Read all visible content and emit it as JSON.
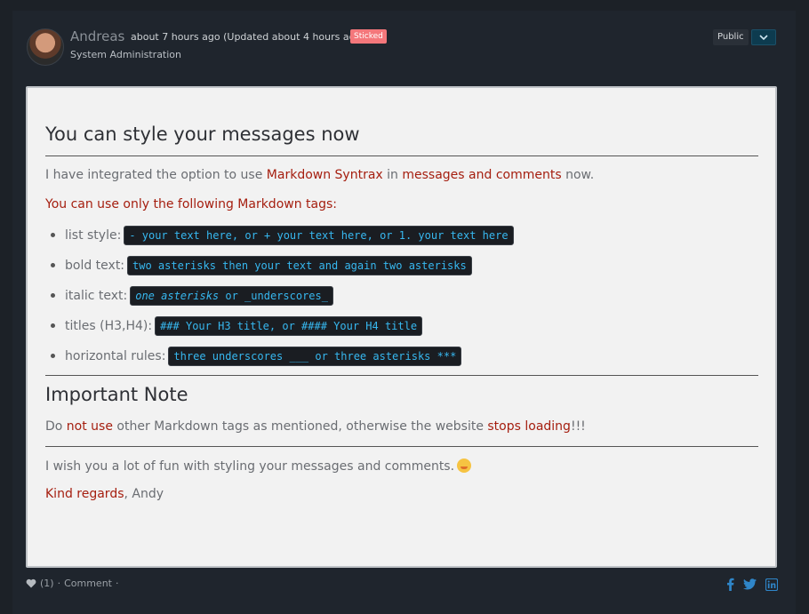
{
  "post": {
    "author": "Andreas",
    "time": "about 7 hours ago (Updated about 4 hours ago)",
    "badge": "Sticked",
    "group": "System Administration",
    "visibility": "Public"
  },
  "message": {
    "title": "You can style your messages now",
    "intro_1": "I have integrated the option to use ",
    "intro_link_1": "Markdown Syntrax",
    "intro_2": " in ",
    "intro_link_2": "messages and comments",
    "intro_3": " now.",
    "tags_heading": "You can use only the following Markdown tags:",
    "items": [
      {
        "label": "list style: ",
        "code": "- your text here, or + your text here, or 1. your text here"
      },
      {
        "label": "bold text: ",
        "code": "two asterisks then your text and again two asterisks"
      },
      {
        "label": "italic text: ",
        "code_italic": "one asterisks",
        "code_rest": " or _underscores_"
      },
      {
        "label": "titles (H3,H4): ",
        "code": "### Your H3 title, or #### Your H4 title"
      },
      {
        "label": "horizontal rules: ",
        "code": "three underscores ___ or three asterisks ***"
      }
    ],
    "note_title": "Important Note",
    "note_1": "Do ",
    "note_link_1": "not use",
    "note_2": " other Markdown tags as mentioned, otherwise the website ",
    "note_link_2": "stops loading",
    "note_3": "!!!",
    "wish": "I wish you a lot of fun with styling your messages and comments.",
    "regards": "Kind regards",
    "signature": ", Andy"
  },
  "footer": {
    "likes": "(1)",
    "sep": "·",
    "comment": "Comment",
    "social": [
      "facebook-icon",
      "twitter-icon",
      "linkedin-icon"
    ]
  },
  "colors": {
    "accent": "#a51e0f",
    "code_text": "#37b8f0",
    "badge": "#f4777b"
  }
}
